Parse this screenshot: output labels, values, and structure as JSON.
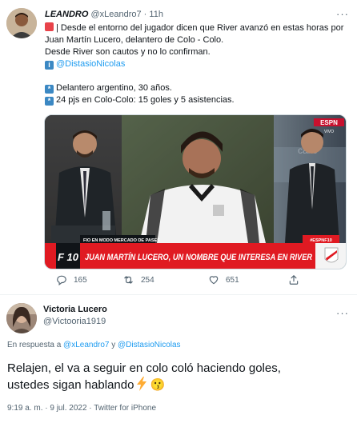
{
  "tweet1": {
    "author_name": "LEANDRO",
    "author_handle": "@xLeandro7",
    "separator": "·",
    "time": "11h",
    "line1": "| Desde el entorno del jugador dicen que River avanzó en estas horas por",
    "line2": "Juan Martín Lucero, delantero de Colo - Colo.",
    "line3": "Desde River son cautos y no lo confirman.",
    "mention_line": "@DistasioNicolas",
    "fact1": "Delantero argentino, 30 años.",
    "fact2": "24 pjs en Colo-Colo: 15 goles y 5 asistencias.",
    "media": {
      "channel_logo": "ESPN",
      "channel_tag": "VIVO",
      "ticker_top": "FIO EN MODO MERCADO DE PASES",
      "ticker_tag": "#ESPNF10",
      "program_logo": "F 10",
      "headline": "JUAN MARTÍN LUCERO, UN NOMBRE QUE INTERESA EN RIVER"
    },
    "replies": "165",
    "retweets": "254",
    "likes": "651"
  },
  "tweet2": {
    "author_name": "Victoria Lucero",
    "author_handle": "@Victooria1919",
    "reply_prefix": "En respuesta a",
    "reply_mention1": "@xLeandro7",
    "reply_conj": "y",
    "reply_mention2": "@DistasioNicolas",
    "text_line1": "Relajen, el va a seguir en colo coló haciendo goles,",
    "text_line2": "ustedes sigan hablando",
    "emoji_end": "😗",
    "timestamp": "9:19 a. m. · 9 jul. 2022 · Twitter for iPhone"
  },
  "colors": {
    "accent": "#1d9bf0",
    "muted": "#536471",
    "ticker_red": "#e01a22"
  },
  "icons": [
    "alarm-emoji-icon",
    "info-emoji-icon",
    "asterisk-emoji-icon",
    "reply-icon",
    "retweet-icon",
    "like-icon",
    "share-icon",
    "more-icon",
    "lightning-emoji-icon"
  ]
}
